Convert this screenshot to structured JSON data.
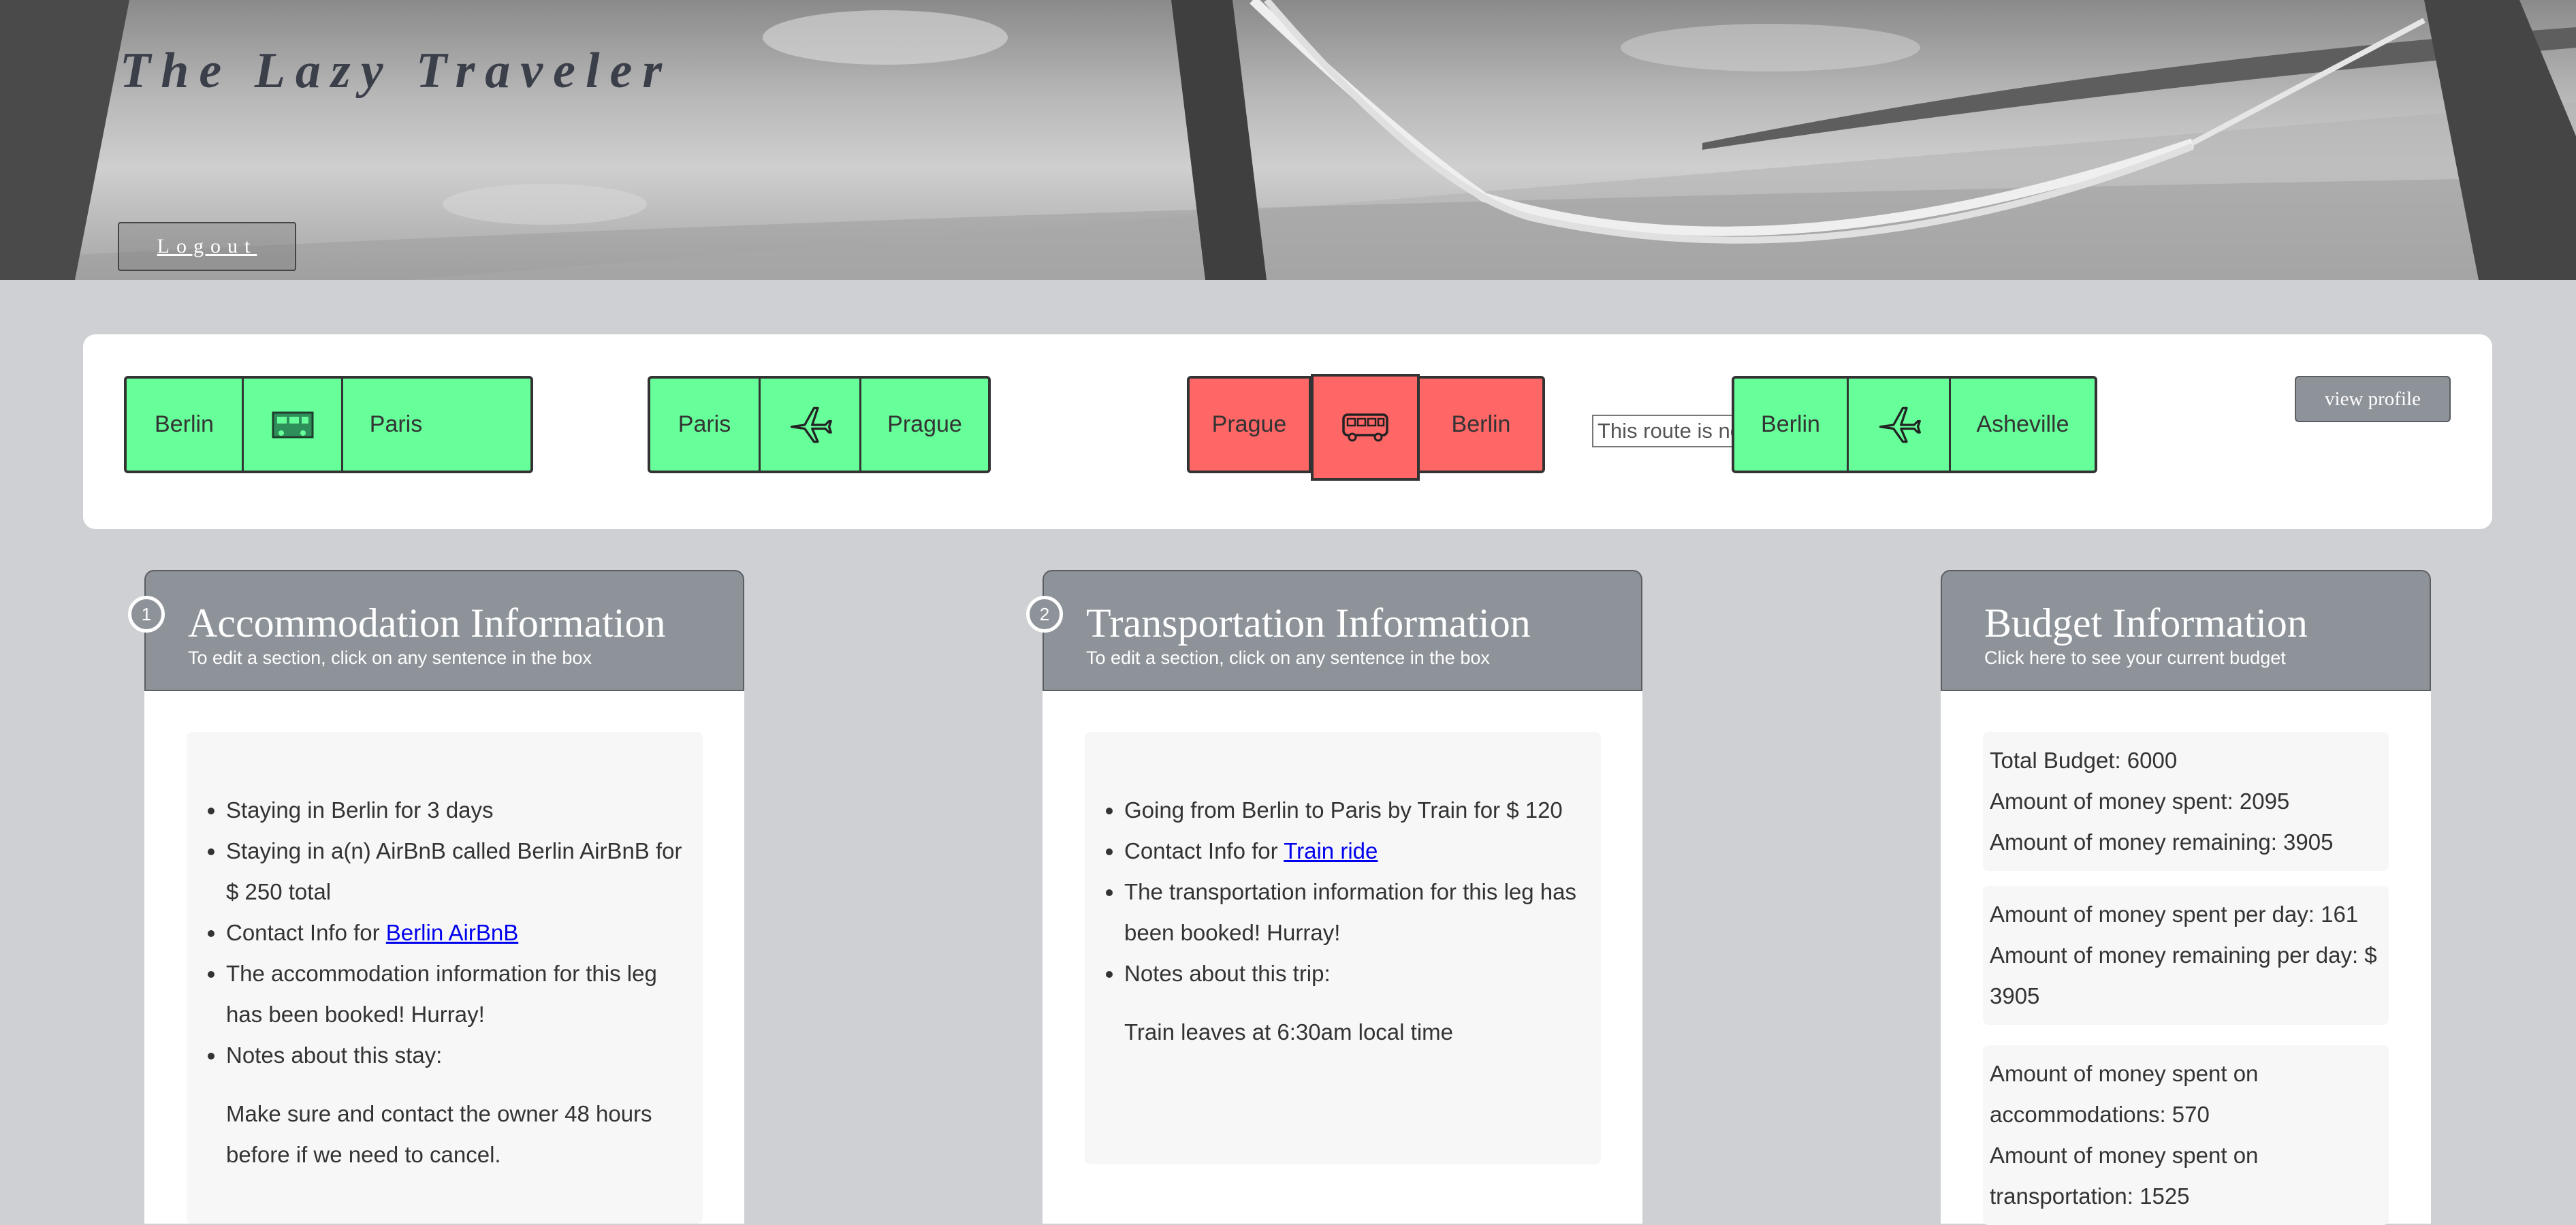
{
  "header": {
    "site_title": "The Lazy Traveler",
    "logout_label": "Logout"
  },
  "routes": [
    {
      "from": "Berlin",
      "to": "Paris",
      "mode": "train-icon",
      "booked": true
    },
    {
      "from": "Paris",
      "to": "Prague",
      "mode": "plane-icon",
      "booked": true
    },
    {
      "from": "Prague",
      "to": "Berlin",
      "mode": "bus-icon",
      "booked": false
    },
    {
      "from": "Berlin",
      "to": "Asheville",
      "mode": "plane-icon",
      "booked": true
    }
  ],
  "route_colors": {
    "booked": "#66ff99",
    "unbooked": "#ff6666"
  },
  "tooltip": "This route is not booked",
  "profile_label": "view profile",
  "accommodation": {
    "badge": "1",
    "title": "Accommodation Information",
    "subtitle": "To edit a section, click on any sentence in the box",
    "item1": "Staying in Berlin for 3 days",
    "item2": "Staying in a(n) AirBnB called Berlin AirBnB for $ 250 total",
    "item3_prefix": "Contact Info for ",
    "item3_link": "Berlin AirBnB",
    "item4": "The accommodation information for this leg has been booked! Hurray!",
    "item5": "Notes about this stay:",
    "note": "Make sure and contact the owner 48 hours before if we need to cancel."
  },
  "transportation": {
    "badge": "2",
    "title": "Transportation Information",
    "subtitle": "To edit a section, click on any sentence in the box",
    "item1": "Going from Berlin to Paris by Train for $ 120",
    "item2_prefix": "Contact Info for ",
    "item2_link": "Train ride",
    "item3": "The transportation information for this leg has been booked! Hurray!",
    "item4": "Notes about this trip:",
    "note": "Train leaves at 6:30am local time"
  },
  "budget": {
    "title": "Budget Information",
    "subtitle": "Click here to see your current budget",
    "total": "Total Budget: 6000",
    "spent": "Amount of money spent: 2095",
    "remaining": "Amount of money remaining: 3905",
    "spent_per_day": "Amount of money spent per day: 161",
    "remaining_per_day": "Amount of money remaining per day: $ 3905",
    "spent_accommodations": "Amount of money spent on accommodations: 570",
    "spent_transportation": "Amount of money spent on transportation: 1525"
  }
}
